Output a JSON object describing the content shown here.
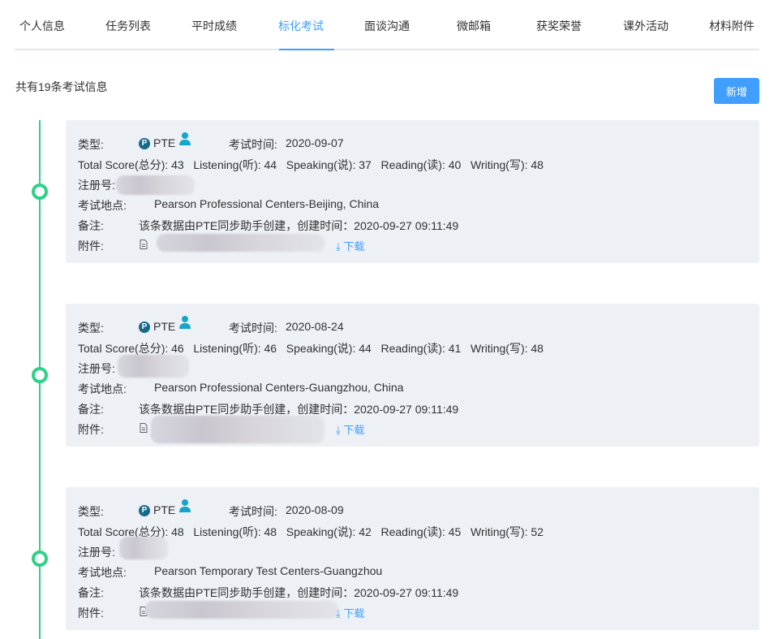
{
  "tabs": [
    {
      "label": "个人信息",
      "active": false
    },
    {
      "label": "任务列表",
      "active": false
    },
    {
      "label": "平时成绩",
      "active": false
    },
    {
      "label": "标化考试",
      "active": true
    },
    {
      "label": "面谈沟通",
      "active": false
    },
    {
      "label": "微邮箱",
      "active": false
    },
    {
      "label": "获奖荣誉",
      "active": false
    },
    {
      "label": "课外活动",
      "active": false
    },
    {
      "label": "材料附件",
      "active": false
    }
  ],
  "summary_text": "共有19条考试信息",
  "add_button_label": "新增",
  "labels": {
    "type": "类型:",
    "exam_time": "考试时间:",
    "reg_no": "注册号:",
    "location": "考试地点:",
    "remark": "备注:",
    "attachment": "附件:",
    "download": "下载"
  },
  "accent_color": "#409eff",
  "timeline_color": "#2fd08a",
  "records": [
    {
      "type": "PTE",
      "exam_time": "2020-09-07",
      "scores": "Total Score(总分): 43   Listening(听): 44   Speaking(说): 37   Reading(读): 40   Writing(写): 48",
      "location": "Pearson Professional Centers-Beijing, China",
      "remark": "该条数据由PTE同步助手创建，创建时间：2020-09-27 09:11:49"
    },
    {
      "type": "PTE",
      "exam_time": "2020-08-24",
      "scores": "Total Score(总分): 46   Listening(听): 46   Speaking(说): 44   Reading(读): 41   Writing(写): 48",
      "location": "Pearson Professional Centers-Guangzhou, China",
      "remark": "该条数据由PTE同步助手创建，创建时间：2020-09-27 09:11:49"
    },
    {
      "type": "PTE",
      "exam_time": "2020-08-09",
      "scores": "Total Score(总分): 48   Listening(听): 48   Speaking(说): 42   Reading(读): 45   Writing(写): 52",
      "location": "Pearson Temporary Test Centers-Guangzhou",
      "remark": "该条数据由PTE同步助手创建，创建时间：2020-09-27 09:11:49"
    }
  ]
}
